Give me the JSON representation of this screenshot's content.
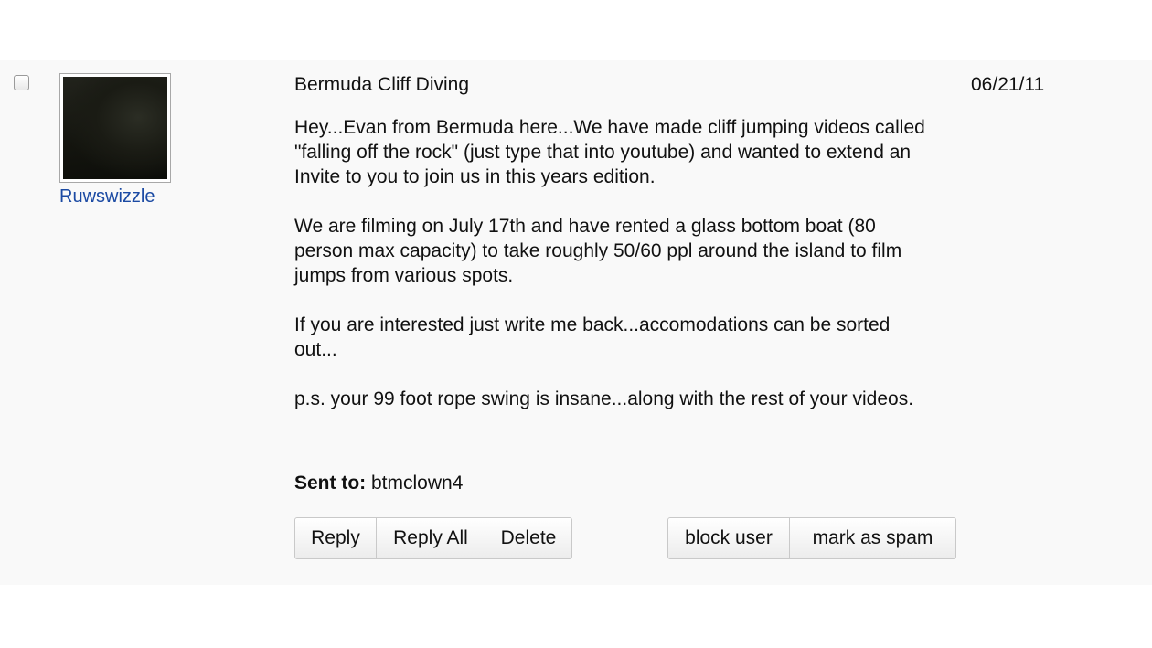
{
  "message": {
    "sender": "Ruwswizzle",
    "subject": "Bermuda Cliff Diving",
    "date": "06/21/11",
    "paragraphs": [
      "Hey...Evan from Bermuda here...We have made cliff jumping videos called \"falling off the rock\" (just type that into youtube) and wanted to extend an Invite to you to join us in this years edition.",
      "We are filming on July 17th and have rented a glass bottom boat (80 person max capacity) to take roughly 50/60 ppl around the island to film jumps from various spots.",
      "If you are interested just write me back...accomodations can be sorted out...",
      "p.s. your 99 foot rope swing is insane...along with the rest of your videos."
    ],
    "sent_to_label": "Sent to:",
    "sent_to_value": "btmclown4"
  },
  "actions": {
    "reply": "Reply",
    "reply_all": "Reply All",
    "delete": "Delete",
    "block_user": "block user",
    "mark_as_spam": "mark as spam"
  },
  "colors": {
    "link": "#1b4aa3",
    "row_background": "#f9f9f9"
  }
}
